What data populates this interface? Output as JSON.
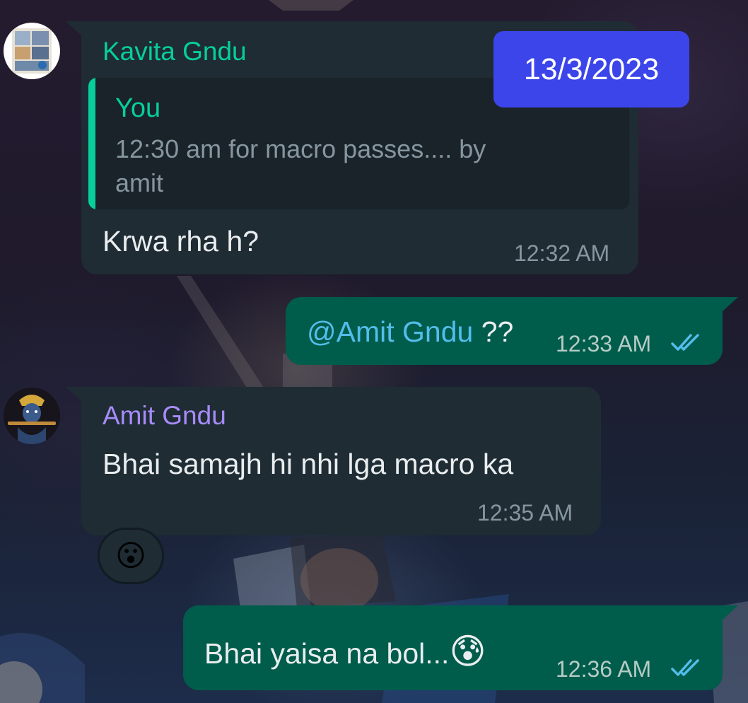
{
  "date_badge": "13/3/2023",
  "messages": [
    {
      "sender": "Kavita Gndu",
      "sender_color": "#06cf9c",
      "quote": {
        "author": "You",
        "text_line1": "12:30 am for macro passes.... by",
        "text_line2": "amit"
      },
      "text": "Krwa rha h?",
      "time": "12:32 AM"
    },
    {
      "mention": "@Amit Gndu",
      "text": " ??",
      "time": "12:33 AM",
      "status": "read-double-check-icon"
    },
    {
      "sender": "Amit Gndu",
      "sender_color": "#a78bfa",
      "text": "Bhai samajh hi nhi lga macro ka",
      "time": "12:35 AM",
      "reaction": "😮"
    },
    {
      "text": "Bhai yaisa na bol...",
      "emoji": "😰",
      "time": "12:36 AM",
      "status": "read-double-check-icon"
    }
  ],
  "colors": {
    "incoming_bubble": "#1f2c34",
    "outgoing_bubble": "#005c4b",
    "mention": "#53bdeb",
    "read_ticks": "#53bdeb",
    "date_badge": "#3b45ea"
  }
}
